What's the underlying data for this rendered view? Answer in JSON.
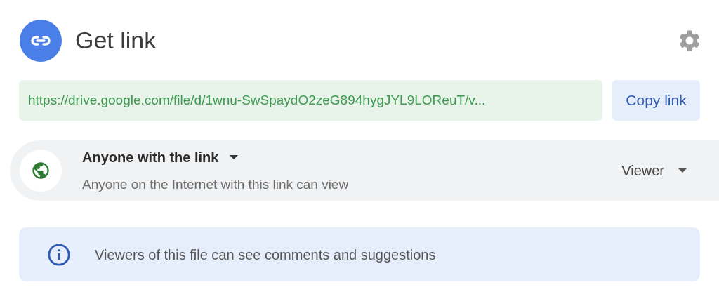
{
  "dialog": {
    "title": "Get link"
  },
  "link": {
    "value": "https://drive.google.com/file/d/1wnu-SwSpaydO2zeG894hygJYL9LOReuT/v...",
    "button": "Copy link"
  },
  "access": {
    "scope": "Anyone with the link",
    "description": "Anyone on the Internet with this link can view",
    "role": "Viewer"
  },
  "notice": {
    "text": "Viewers of this file can see comments and suggestions"
  }
}
